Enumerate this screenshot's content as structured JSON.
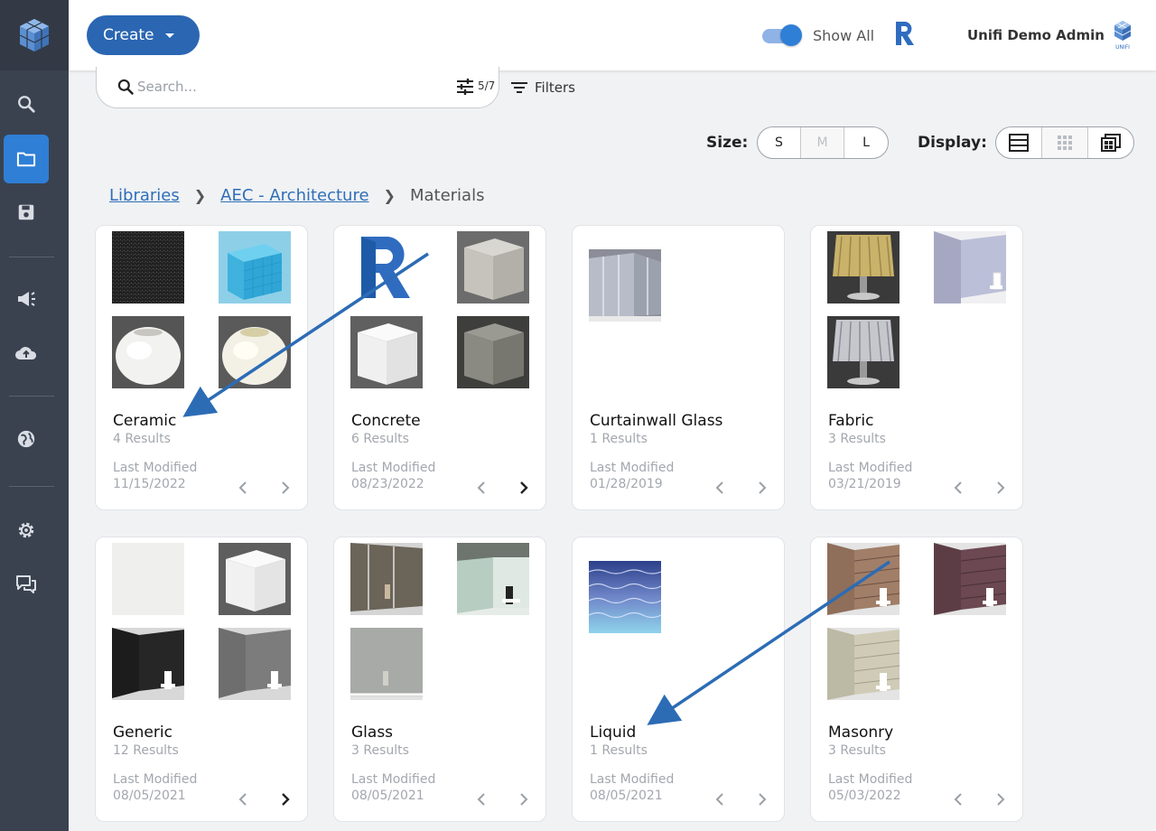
{
  "header": {
    "create_label": "Create",
    "show_all_label": "Show All",
    "show_all_enabled": true,
    "user_name": "Unifi Demo Admin",
    "unifi_logo_text": "UNIFI"
  },
  "sidebar": {
    "items": [
      {
        "name": "search",
        "icon": "search-icon"
      },
      {
        "name": "libraries",
        "icon": "folder-icon",
        "active": true
      },
      {
        "name": "saved",
        "icon": "save-icon"
      },
      {
        "name": "announcements",
        "icon": "megaphone-icon"
      },
      {
        "name": "upload",
        "icon": "cloud-upload-icon"
      },
      {
        "name": "web",
        "icon": "globe-icon"
      },
      {
        "name": "settings",
        "icon": "gear-icon"
      },
      {
        "name": "chat",
        "icon": "chat-icon"
      }
    ]
  },
  "search": {
    "placeholder": "Search...",
    "filter_count": "5/7",
    "filters_label": "Filters"
  },
  "size": {
    "label": "Size:",
    "options": [
      "S",
      "M",
      "L"
    ],
    "disabled": "M"
  },
  "display": {
    "label": "Display:",
    "options": [
      "list-view-icon",
      "grid-view-icon",
      "gallery-view-icon"
    ]
  },
  "breadcrumb": {
    "items": [
      "Libraries",
      "AEC - Architecture"
    ],
    "current": "Materials"
  },
  "cards": [
    {
      "title": "Ceramic",
      "count": "4 Results",
      "modified_label": "Last Modified",
      "date": "11/15/2022",
      "next_enabled": false
    },
    {
      "title": "Concrete",
      "count": "6 Results",
      "modified_label": "Last Modified",
      "date": "08/23/2022",
      "next_enabled": true
    },
    {
      "title": "Curtainwall Glass",
      "count": "1 Results",
      "modified_label": "Last Modified",
      "date": "01/28/2019",
      "next_enabled": false
    },
    {
      "title": "Fabric",
      "count": "3 Results",
      "modified_label": "Last Modified",
      "date": "03/21/2019",
      "next_enabled": false
    },
    {
      "title": "Generic",
      "count": "12 Results",
      "modified_label": "Last Modified",
      "date": "08/05/2021",
      "next_enabled": true
    },
    {
      "title": "Glass",
      "count": "3 Results",
      "modified_label": "Last Modified",
      "date": "08/05/2021",
      "next_enabled": false
    },
    {
      "title": "Liquid",
      "count": "1 Results",
      "modified_label": "Last Modified",
      "date": "08/05/2021",
      "next_enabled": false
    },
    {
      "title": "Masonry",
      "count": "3 Results",
      "modified_label": "Last Modified",
      "date": "05/03/2022",
      "next_enabled": false
    }
  ],
  "colors": {
    "sidebar": "#3a4250",
    "accent": "#2b66b3",
    "annotation_arrow": "#2c6cb5"
  }
}
